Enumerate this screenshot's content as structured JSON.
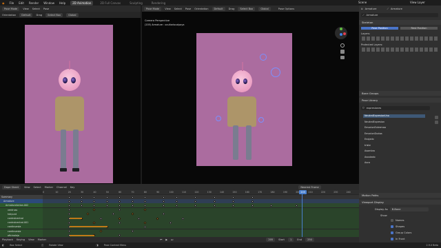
{
  "topbar": {
    "menus": [
      "File",
      "Edit",
      "Render",
      "Window",
      "Help"
    ],
    "workspaces": [
      "2D Animation",
      "2D Full Canvas",
      "Sculpting",
      "Rendering"
    ],
    "active_workspace": "2D Animation",
    "scene_label": "Scene",
    "view_layer_label": "View Layer"
  },
  "left_viewport": {
    "header": [
      "Pose Mode",
      "View",
      "Select",
      "Pose"
    ],
    "orientation_label": "Orientation",
    "orientation_value": "Default",
    "drag_label": "Drag",
    "drag_value": "Select Box",
    "global_value": "Global"
  },
  "right_viewport": {
    "header": [
      "Pose Mode",
      "View",
      "Select",
      "Pose"
    ],
    "orientation_label": "Orientation",
    "orientation_value": "Default",
    "drag_label": "Drag",
    "drag_value": "Select Box",
    "global_value": "Global",
    "pose_options": "Pose Options",
    "camera_label": "Camera Perspective",
    "object_label": "(205) Armature : ocultarlocalpaya"
  },
  "properties": {
    "object_name": "Armature",
    "data_name": "Armature",
    "armature_field": "Armature",
    "skeleton_title": "Skeleton",
    "pose_position": "Pose Position",
    "rest_position": "Rest Position",
    "layers_label": "Layers:",
    "protected_layers_label": "Protected Layers:",
    "bone_groups_title": "Bone Groups",
    "pose_library_title": "Pose Library",
    "pose_library_field": "expresiones",
    "poses": [
      "NeutralExpresionUno",
      "NeutralExpresion",
      "EmocionExtremaa",
      "EmocionDudaa",
      "Enojado",
      "triste",
      "Asombro",
      "Asustado",
      "Asco"
    ],
    "selected_pose_index": 0,
    "motion_paths_title": "Motion Paths",
    "viewport_display_title": "Viewport Display",
    "display_as_label": "Display As",
    "display_as_value": "B-Bone",
    "show_label": "Show",
    "show_options": [
      "Names",
      "Shapes",
      "Group Colors",
      "In Front"
    ],
    "show_checked": [
      false,
      true,
      true,
      true
    ]
  },
  "dopesheet": {
    "header": [
      "Dope Sheet",
      "View",
      "Select",
      "Marker",
      "Channel",
      "Key"
    ],
    "nearest_frame": "Nearest Frame",
    "frame_ticks": [
      "0",
      "5",
      "10",
      "15",
      "20",
      "25",
      "30",
      "35",
      "40",
      "45",
      "50",
      "55",
      "60",
      "65",
      "70",
      "75",
      "80",
      "85",
      "90",
      "95",
      "100",
      "105",
      "110",
      "115",
      "120",
      "125",
      "130",
      "135",
      "140",
      "145",
      "150",
      "155",
      "160",
      "165",
      "170",
      "175",
      "180",
      "185",
      "190",
      "195",
      "200",
      "205",
      "210",
      "215",
      "220",
      "225",
      "230",
      "235",
      "240",
      "245"
    ],
    "current_frame": "205",
    "channels": [
      "Summary",
      "Armature",
      "ArmatureAction.002",
      "ventruss",
      "hdrpunt",
      "controlcentral",
      "controlcentral.001",
      "cantinuesta",
      "cantinuesta",
      "oficinaleja",
      "ocultarlocalpaya"
    ]
  },
  "timeline": {
    "header": [
      "Playback",
      "Keying",
      "View",
      "Marker"
    ],
    "frame_value": "205",
    "start_label": "Start",
    "start_value": "1",
    "end_label": "End",
    "end_value": "250"
  },
  "statusbar": {
    "items": [
      "Box Select",
      "Rotate View",
      "Pose Context Menu"
    ],
    "version": "2.9.0 Beta"
  },
  "colors": {
    "accent": "#4a74c8",
    "canvas_pink": "#ab6c9f",
    "keyframe_orange": "#f0a020",
    "playhead": "#4a80d0"
  }
}
